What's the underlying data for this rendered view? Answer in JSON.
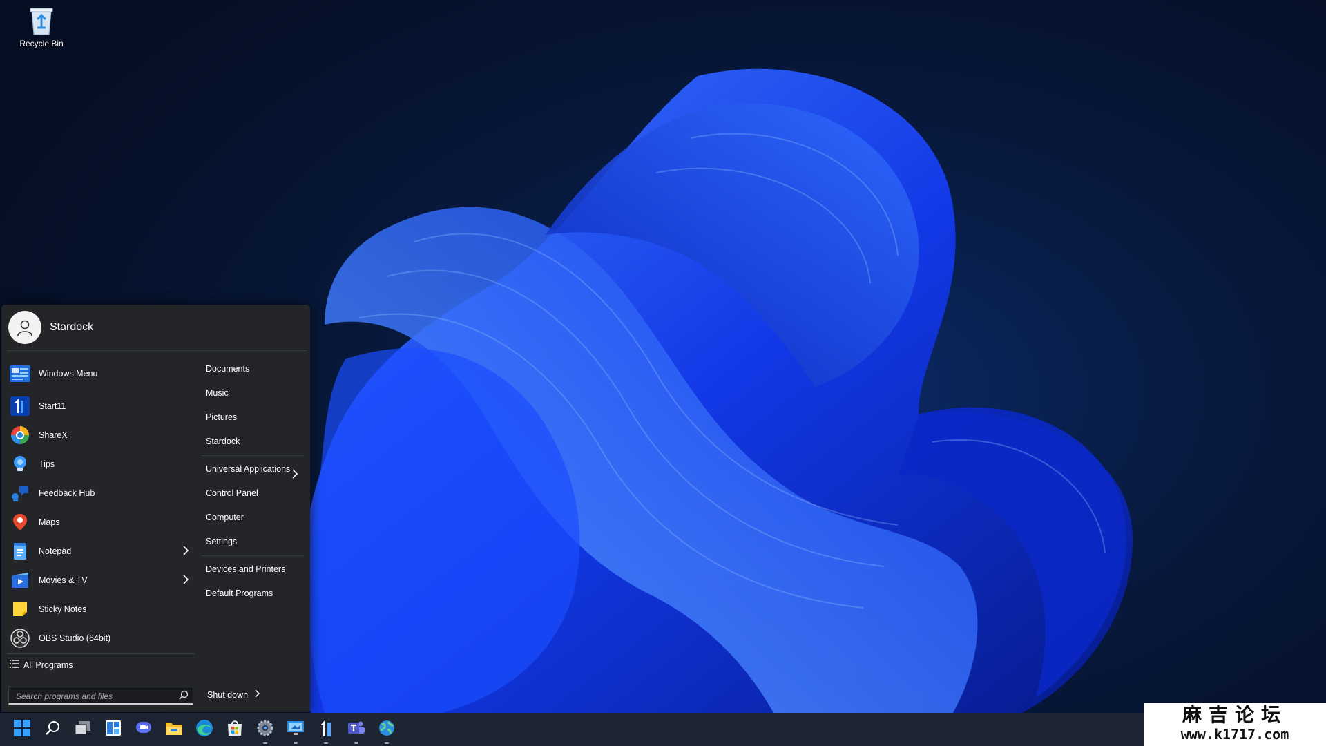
{
  "desktop": {
    "icons": [
      {
        "label": "Recycle Bin",
        "icon": "recycle-bin-icon"
      }
    ]
  },
  "start_menu": {
    "user_name": "Stardock",
    "pinned_apps": [
      {
        "label": "Windows Menu",
        "icon": "windows-menu-icon",
        "submenu": false
      },
      {
        "label": "Start11",
        "icon": "start11-icon",
        "submenu": false
      },
      {
        "label": "ShareX",
        "icon": "sharex-icon",
        "submenu": false
      },
      {
        "label": "Tips",
        "icon": "tips-icon",
        "submenu": false
      },
      {
        "label": "Feedback Hub",
        "icon": "feedback-hub-icon",
        "submenu": false
      },
      {
        "label": "Maps",
        "icon": "maps-icon",
        "submenu": false
      },
      {
        "label": "Notepad",
        "icon": "notepad-icon",
        "submenu": true
      },
      {
        "label": "Movies & TV",
        "icon": "movies-tv-icon",
        "submenu": true
      },
      {
        "label": "Sticky Notes",
        "icon": "sticky-notes-icon",
        "submenu": false
      },
      {
        "label": "OBS Studio (64bit)",
        "icon": "obs-studio-icon",
        "submenu": false
      }
    ],
    "all_programs": "All Programs",
    "search_placeholder": "Search programs and files",
    "places": [
      {
        "label": "Documents"
      },
      {
        "label": "Music"
      },
      {
        "label": "Pictures"
      },
      {
        "label": "Stardock"
      },
      {
        "label": "Universal Applications",
        "submenu": true
      },
      {
        "label": "Control Panel"
      },
      {
        "label": "Computer"
      },
      {
        "label": "Settings"
      },
      {
        "label": "Devices and Printers"
      },
      {
        "label": "Default Programs"
      }
    ],
    "shutdown_label": "Shut down"
  },
  "taskbar": {
    "items": [
      {
        "icon": "start-button-icon",
        "running": false
      },
      {
        "icon": "search-icon",
        "running": false
      },
      {
        "icon": "task-view-icon",
        "running": false
      },
      {
        "icon": "widgets-icon",
        "running": false
      },
      {
        "icon": "chat-icon",
        "running": false
      },
      {
        "icon": "file-explorer-icon",
        "running": false
      },
      {
        "icon": "edge-icon",
        "running": false
      },
      {
        "icon": "store-icon",
        "running": false
      },
      {
        "icon": "settings-icon",
        "running": true
      },
      {
        "icon": "remote-desktop-icon",
        "running": true
      },
      {
        "icon": "start11-icon",
        "running": true
      },
      {
        "icon": "teams-icon",
        "running": true
      },
      {
        "icon": "network-globe-icon",
        "running": true
      }
    ]
  },
  "watermark": {
    "line1": "麻吉论坛",
    "line2": "www.k1717.com"
  },
  "colors": {
    "accent": "#1a5cff",
    "menu_bg": "#232528",
    "taskbar_bg": "#1d2533"
  }
}
